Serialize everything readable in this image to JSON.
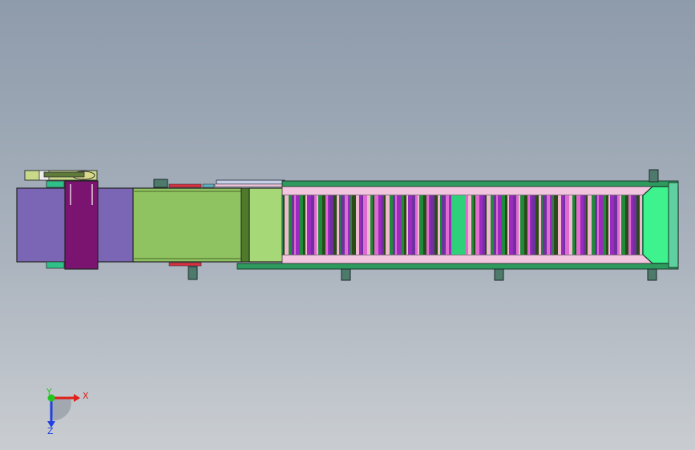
{
  "triad": {
    "x_label": "X",
    "y_label": "Y",
    "z_label": "Z",
    "x_color": "#e0201a",
    "y_color": "#1fc71f",
    "z_color": "#2040e0"
  },
  "colors": {
    "background_top": "#8e9bab",
    "background_bottom": "#c9cdd1",
    "motor_box": "#7b66b5",
    "motor_plate": "#7a1470",
    "feed_section": "#8fc260",
    "pink_guard": "#f3c6e0",
    "end_cover": "#3ef28e",
    "frame_green": "#2f9a5e",
    "legs": "#4d7a6a"
  },
  "stripe_palette": [
    "#2a4a18",
    "#3bbf7a",
    "#c21a4a",
    "#e06bd0",
    "#6fe0c0",
    "#e8c020",
    "#f2b8d0",
    "#2aa8e0",
    "#b7e070",
    "#9a2ac0",
    "#ffffff",
    "#c8d0ff",
    "#1f8a3a",
    "#e04848",
    "#f0e070",
    "#7030a0",
    "#30c0a0",
    "#c0a080"
  ]
}
